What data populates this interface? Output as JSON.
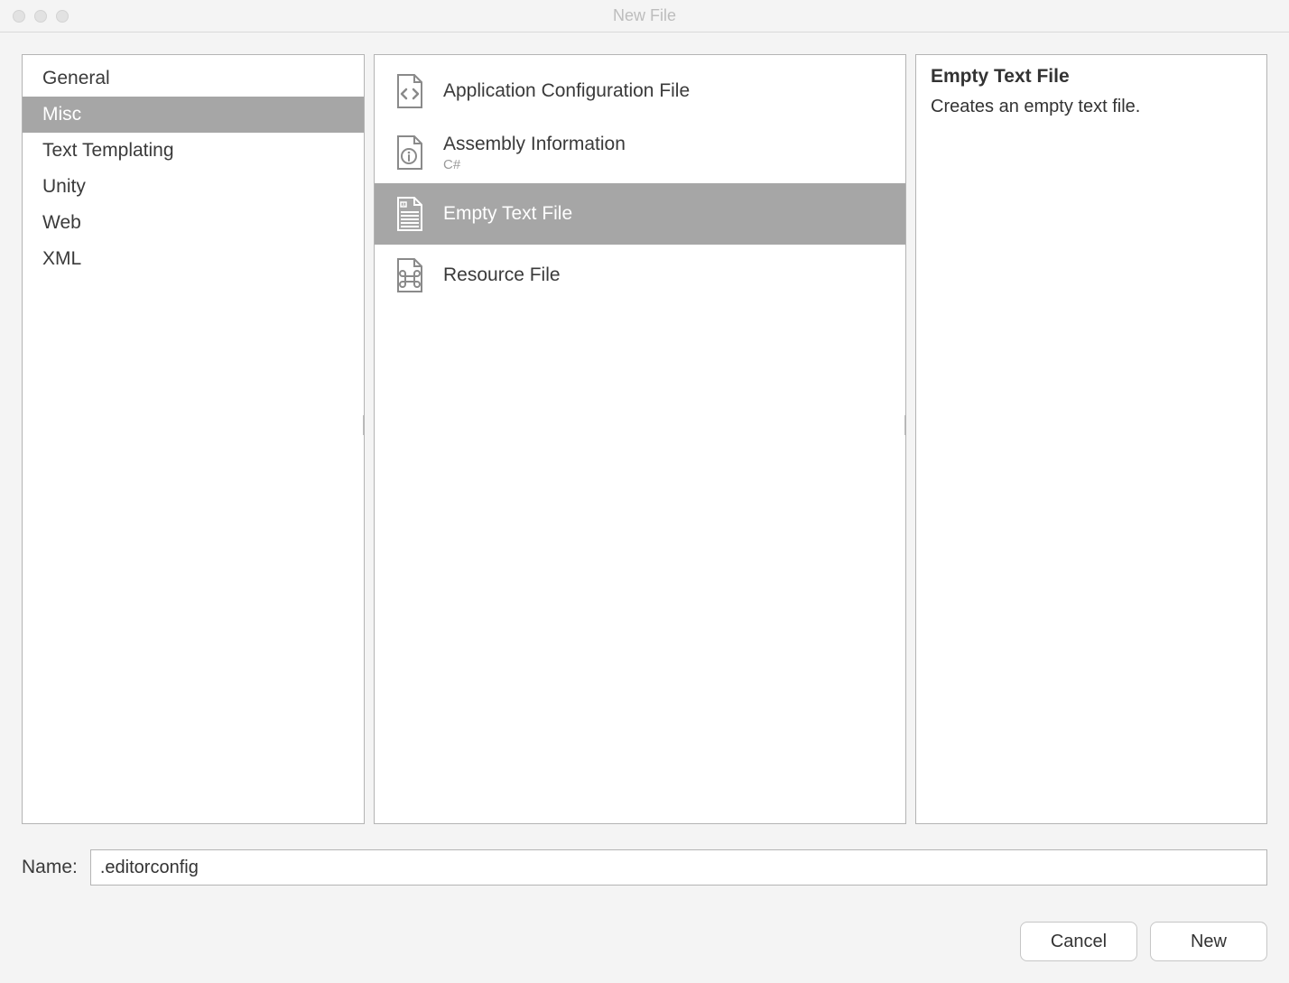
{
  "window": {
    "title": "New File"
  },
  "categories": [
    {
      "label": "General",
      "selected": false
    },
    {
      "label": "Misc",
      "selected": true
    },
    {
      "label": "Text Templating",
      "selected": false
    },
    {
      "label": "Unity",
      "selected": false
    },
    {
      "label": "Web",
      "selected": false
    },
    {
      "label": "XML",
      "selected": false
    }
  ],
  "templates": [
    {
      "label": "Application Configuration File",
      "sub": "",
      "icon": "code-file-icon",
      "selected": false
    },
    {
      "label": "Assembly Information",
      "sub": "C#",
      "icon": "info-file-icon",
      "selected": false
    },
    {
      "label": "Empty Text File",
      "sub": "",
      "icon": "text-file-icon",
      "selected": true
    },
    {
      "label": "Resource File",
      "sub": "",
      "icon": "command-file-icon",
      "selected": false
    }
  ],
  "details": {
    "title": "Empty Text File",
    "description": "Creates an empty text file."
  },
  "name_field": {
    "label": "Name:",
    "value": ".editorconfig"
  },
  "buttons": {
    "cancel": "Cancel",
    "new": "New"
  }
}
